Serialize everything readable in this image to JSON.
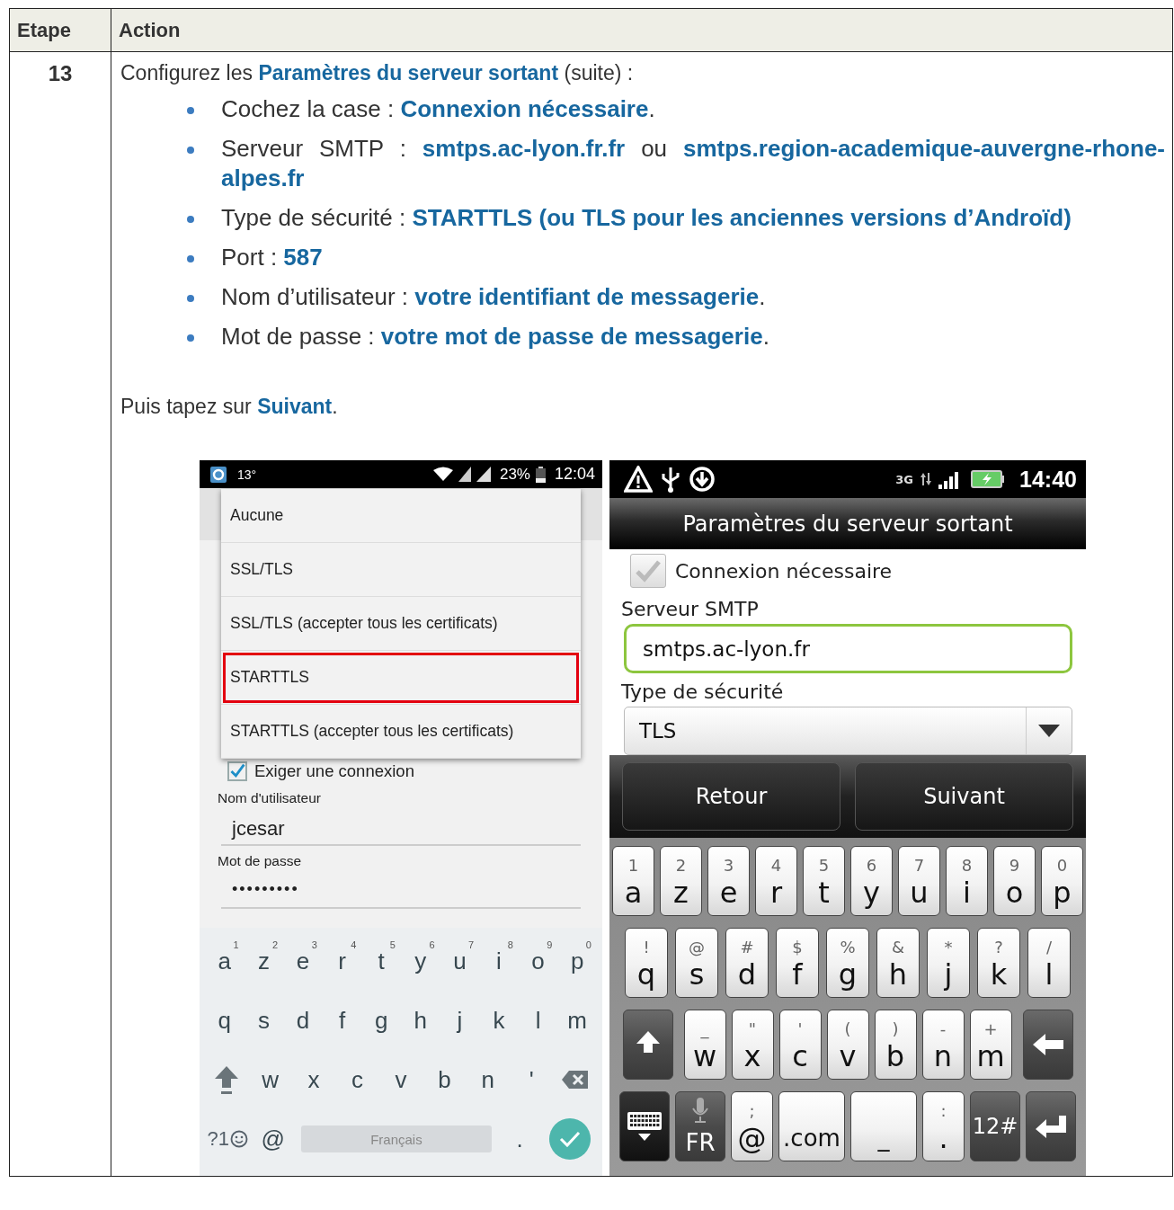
{
  "table": {
    "columns": [
      "Etape",
      "Action"
    ],
    "rows": [
      {
        "step": "13",
        "intro": "Configurez les **Paramètres du serveur sortant** (suite) :",
        "bullets": [
          "Cochez la case : **Connexion nécessaire**.",
          "Serveur SMTP : **smtps.ac-lyon.fr.fr** ou **smtps.region-academique-auvergne-rhone-alpes.fr**",
          "Type de sécurité : **STARTTLS (ou TLS pour les anciennes versions d’Androïd)**",
          "Port : **587**",
          "Nom d’utilisateur : **votre identifiant de messagerie**.",
          "Mot de passe : **votre mot de passe de messagerie**."
        ],
        "outro": "Puis tapez sur **Suivant**.",
        "phone_1": {
          "status_bar": {
            "temperature": "13°",
            "battery": "23%",
            "time": "12:04"
          },
          "dropdown": [
            {
              "label": "Aucune",
              "selected": false
            },
            {
              "label": "SSL/TLS",
              "selected": false
            },
            {
              "label": "SSL/TLS (accepter tous les certificats)",
              "selected": false
            },
            {
              "label": "STARTTLS",
              "selected": true
            },
            {
              "label": "STARTTLS (accepter tous les certificats)",
              "selected": false
            }
          ],
          "checkbox": {
            "label": "Exiger une connexion",
            "checked": true
          },
          "fields": [
            {
              "label": "Nom d'utilisateur",
              "value": "jcesar"
            },
            {
              "label": "Mot de passe",
              "value": "•••••••••"
            }
          ],
          "keyboard": [
            [
              {
                "kind": "char",
                "label": "a",
                "hint": "1"
              },
              {
                "kind": "char",
                "label": "z",
                "hint": "2"
              },
              {
                "kind": "char",
                "label": "e",
                "hint": "3"
              },
              {
                "kind": "char",
                "label": "r",
                "hint": "4"
              },
              {
                "kind": "char",
                "label": "t",
                "hint": "5"
              },
              {
                "kind": "char",
                "label": "y",
                "hint": "6"
              },
              {
                "kind": "char",
                "label": "u",
                "hint": "7"
              },
              {
                "kind": "char",
                "label": "i",
                "hint": "8"
              },
              {
                "kind": "char",
                "label": "o",
                "hint": "9"
              },
              {
                "kind": "char",
                "label": "p",
                "hint": "0"
              }
            ],
            [
              {
                "kind": "char",
                "label": "q"
              },
              {
                "kind": "char",
                "label": "s"
              },
              {
                "kind": "char",
                "label": "d"
              },
              {
                "kind": "char",
                "label": "f"
              },
              {
                "kind": "char",
                "label": "g"
              },
              {
                "kind": "char",
                "label": "h"
              },
              {
                "kind": "char",
                "label": "j"
              },
              {
                "kind": "char",
                "label": "k"
              },
              {
                "kind": "char",
                "label": "l"
              },
              {
                "kind": "char",
                "label": "m"
              }
            ],
            [
              {
                "kind": "shift"
              },
              {
                "kind": "char",
                "label": "w"
              },
              {
                "kind": "char",
                "label": "x"
              },
              {
                "kind": "char",
                "label": "c"
              },
              {
                "kind": "char",
                "label": "v"
              },
              {
                "kind": "char",
                "label": "b"
              },
              {
                "kind": "char",
                "label": "n"
              },
              {
                "kind": "char",
                "label": "'"
              },
              {
                "kind": "backspace"
              }
            ],
            [
              {
                "kind": "symbols",
                "label": "?1"
              },
              {
                "kind": "char",
                "label": "@"
              },
              {
                "kind": "space",
                "label": "Français"
              },
              {
                "kind": "char",
                "label": "."
              },
              {
                "kind": "done"
              }
            ]
          ]
        },
        "phone_2": {
          "status_bar": {
            "network": "3G",
            "time": "14:40"
          },
          "title": "Paramètres du serveur sortant",
          "checkbox": {
            "label": "Connexion nécessaire",
            "checked": true
          },
          "server": {
            "label": "Serveur SMTP",
            "value": "smtps.ac-lyon.fr"
          },
          "security": {
            "label": "Type de sécurité",
            "value": "TLS"
          },
          "buttons": [
            "Retour",
            "Suivant"
          ],
          "keyboard": [
            [
              {
                "kind": "char",
                "label": "a",
                "hint": "1"
              },
              {
                "kind": "char",
                "label": "z",
                "hint": "2"
              },
              {
                "kind": "char",
                "label": "e",
                "hint": "3"
              },
              {
                "kind": "char",
                "label": "r",
                "hint": "4"
              },
              {
                "kind": "char",
                "label": "t",
                "hint": "5"
              },
              {
                "kind": "char",
                "label": "y",
                "hint": "6"
              },
              {
                "kind": "char",
                "label": "u",
                "hint": "7"
              },
              {
                "kind": "char",
                "label": "i",
                "hint": "8"
              },
              {
                "kind": "char",
                "label": "o",
                "hint": "9"
              },
              {
                "kind": "char",
                "label": "p",
                "hint": "0"
              }
            ],
            [
              {
                "kind": "char",
                "label": "q",
                "hint": "!"
              },
              {
                "kind": "char",
                "label": "s",
                "hint": "@"
              },
              {
                "kind": "char",
                "label": "d",
                "hint": "#"
              },
              {
                "kind": "char",
                "label": "f",
                "hint": "$"
              },
              {
                "kind": "char",
                "label": "g",
                "hint": "%"
              },
              {
                "kind": "char",
                "label": "h",
                "hint": "&"
              },
              {
                "kind": "char",
                "label": "j",
                "hint": "*"
              },
              {
                "kind": "char",
                "label": "k",
                "hint": "?"
              },
              {
                "kind": "char",
                "label": "l",
                "hint": "/"
              }
            ],
            [
              {
                "kind": "shift"
              },
              {
                "kind": "char",
                "label": "w",
                "hint": "_"
              },
              {
                "kind": "char",
                "label": "x",
                "hint": "\""
              },
              {
                "kind": "char",
                "label": "c",
                "hint": "'"
              },
              {
                "kind": "char",
                "label": "v",
                "hint": "("
              },
              {
                "kind": "char",
                "label": "b",
                "hint": ")"
              },
              {
                "kind": "char",
                "label": "n",
                "hint": "-"
              },
              {
                "kind": "char",
                "label": "m",
                "hint": "+"
              },
              {
                "kind": "backspace"
              }
            ],
            [
              {
                "kind": "hide"
              },
              {
                "kind": "mic",
                "label": "FR"
              },
              {
                "kind": "char",
                "label": "@",
                "hint": ";"
              },
              {
                "kind": "text",
                "label": ".com"
              },
              {
                "kind": "text",
                "label": "_"
              },
              {
                "kind": "char",
                "label": ".",
                "hint": ":"
              },
              {
                "kind": "func",
                "label": "12#"
              },
              {
                "kind": "enter"
              }
            ]
          ]
        }
      }
    ]
  }
}
